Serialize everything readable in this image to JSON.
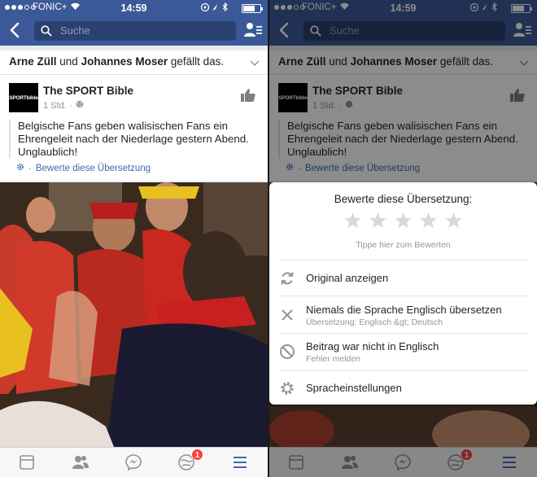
{
  "status_bar": {
    "carrier": "FONIC+",
    "time": "14:59",
    "battery_level": 0.7
  },
  "nav": {
    "search_placeholder": "Suche"
  },
  "story": {
    "liker_1": "Arne Züll",
    "conjunction": "und",
    "liker_2": "Johannes Moser",
    "suffix": "gefällt das.",
    "page_name": "The SPORT Bible",
    "logo_text": "SPORTbible",
    "time_ago": "1 Std.",
    "translated_text": "Belgische Fans geben walisischen Fans ein Ehrengeleit nach der Niederlage gestern Abend. Unglaublich!",
    "rate_translation": "Bewerte diese Übersetzung"
  },
  "tab_bar": {
    "items": [
      "news-feed",
      "friends",
      "messenger",
      "notifications",
      "menu"
    ],
    "notification_badge": "1"
  },
  "translation_sheet": {
    "title": "Bewerte diese Übersetzung:",
    "star_count": 5,
    "hint": "Tippe hier zum Bewerten",
    "options": [
      {
        "label": "Original anzeigen",
        "sublabel": "",
        "icon": "refresh-icon"
      },
      {
        "label": "Niemals die Sprache Englisch übersetzen",
        "sublabel": "Übersetzung: Englisch &gt; Deutsch",
        "icon": "close-icon"
      },
      {
        "label": "Beitrag war nicht in Englisch",
        "sublabel": "Fehler melden",
        "icon": "block-icon"
      },
      {
        "label": "Spracheinstellungen",
        "sublabel": "",
        "icon": "gear-icon"
      }
    ]
  },
  "colors": {
    "brand_blue": "#3b5998",
    "link_blue": "#4267b2",
    "badge_red": "#fa3e3e",
    "background": "#e9ebee"
  }
}
